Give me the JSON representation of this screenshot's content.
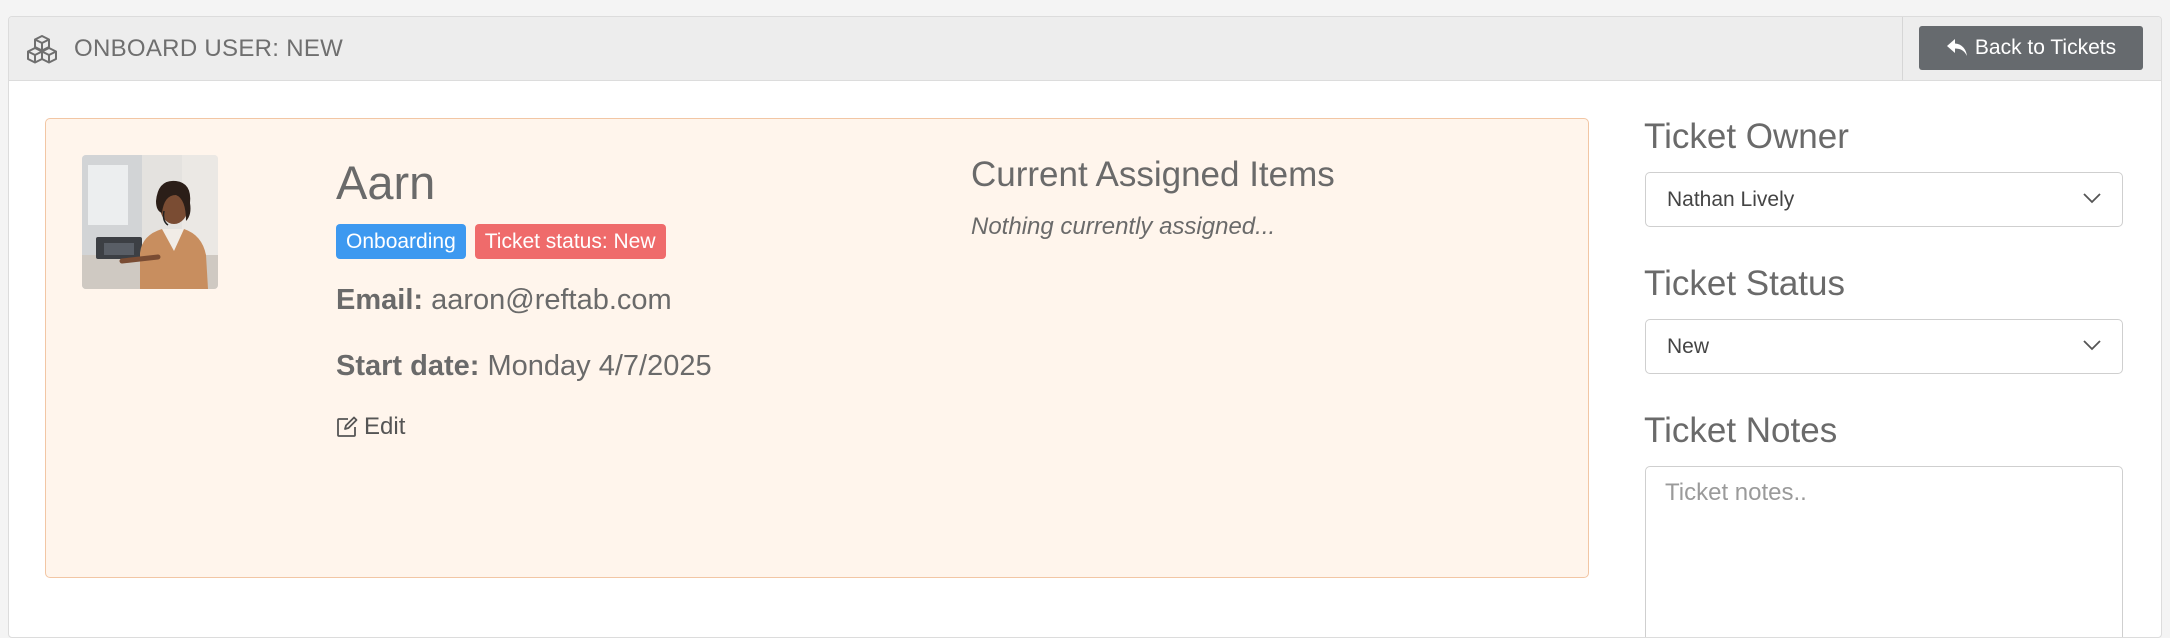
{
  "header": {
    "title": "ONBOARD USER: NEW",
    "icon": "cubes-icon",
    "back_button_label": "Back to Tickets",
    "back_button_icon": "reply-arrow-icon"
  },
  "user": {
    "name": "Aarn",
    "avatar": "user-avatar-photo",
    "badges": [
      {
        "label": "Onboarding",
        "color": "#3d99f0"
      },
      {
        "label": "Ticket status: New",
        "color": "#ef6b6b"
      }
    ],
    "email_label": "Email:",
    "email_value": "aaron@reftab.com",
    "start_label": "Start date:",
    "start_value": "Monday 4/7/2025",
    "edit_label": "Edit",
    "edit_icon": "edit-icon"
  },
  "assigned": {
    "title": "Current Assigned Items",
    "empty_text": "Nothing currently assigned..."
  },
  "sidebar": {
    "owner_label": "Ticket Owner",
    "owner_value": "Nathan Lively",
    "status_label": "Ticket Status",
    "status_value": "New",
    "notes_label": "Ticket Notes",
    "notes_placeholder": "Ticket notes.."
  },
  "colors": {
    "card_background": "#fff5ec",
    "card_border": "#f2c6a4",
    "back_button": "#666a6e"
  }
}
